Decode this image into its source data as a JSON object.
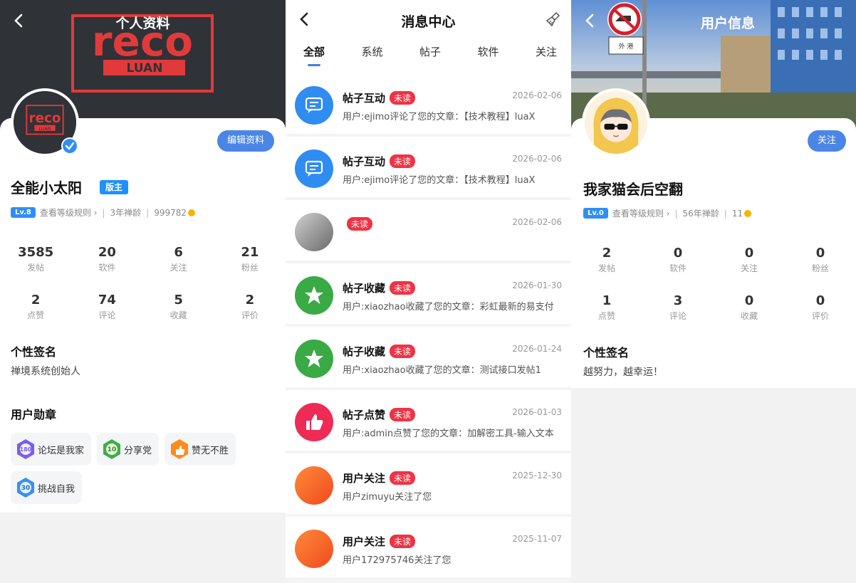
{
  "profile": {
    "title": "个人资料",
    "logo_text": "reco",
    "logo_sub": "LUAN",
    "edit_label": "编辑资料",
    "username": "全能小太阳",
    "role": "版主",
    "level": "Lv.8",
    "level_rule": "查看等级规则 ›",
    "age": "3年禅龄",
    "coins": "999782",
    "stats_row1": [
      {
        "n": "3585",
        "l": "发帖"
      },
      {
        "n": "20",
        "l": "软件"
      },
      {
        "n": "6",
        "l": "关注"
      },
      {
        "n": "21",
        "l": "粉丝"
      }
    ],
    "stats_row2": [
      {
        "n": "2",
        "l": "点赞"
      },
      {
        "n": "74",
        "l": "评论"
      },
      {
        "n": "5",
        "l": "收藏"
      },
      {
        "n": "2",
        "l": "评价"
      }
    ],
    "sig_title": "个性签名",
    "sig_text": "禅境系统创始人",
    "medal_title": "用户勋章",
    "medals": [
      {
        "label": "论坛是我家",
        "badge": "180",
        "color": "#7b5cf0"
      },
      {
        "label": "分享党",
        "badge": "10",
        "color": "#3fae49"
      },
      {
        "label": "赞无不胜",
        "badge": "",
        "color": "#ff8c1a"
      },
      {
        "label": "挑战自我",
        "badge": "30",
        "color": "#3b8ff0"
      }
    ]
  },
  "messages": {
    "title": "消息中心",
    "tabs": [
      "全部",
      "系统",
      "帖子",
      "软件",
      "关注"
    ],
    "active_tab": "全部",
    "unread_label": "未读",
    "items": [
      {
        "type": "帖子互动",
        "date": "2026-02-06",
        "body": "用户:ejimo评论了您的文章：【技术教程】luaX",
        "icon": "comment-icon",
        "color": "#2f8cf0"
      },
      {
        "type": "帖子互动",
        "date": "2026-02-06",
        "body": "用户:ejimo评论了您的文章：【技术教程】luaX",
        "icon": "comment-icon",
        "color": "#2f8cf0"
      },
      {
        "type": "",
        "date": "2026-02-06",
        "body": "",
        "icon": "system-icon",
        "color": "#8a8a8a"
      },
      {
        "type": "帖子收藏",
        "date": "2026-01-30",
        "body": "用户:xiaozhao收藏了您的文章：彩虹最新的易支付",
        "icon": "star-icon",
        "color": "#3aaa45"
      },
      {
        "type": "帖子收藏",
        "date": "2026-01-24",
        "body": "用户:xiaozhao收藏了您的文章：测试接口发帖1",
        "icon": "star-icon",
        "color": "#3aaa45"
      },
      {
        "type": "帖子点赞",
        "date": "2026-01-03",
        "body": "用户:admin点赞了您的文章：加解密工具-输入文本",
        "icon": "thumb-up-icon",
        "color": "#ee2a55"
      },
      {
        "type": "用户关注",
        "date": "2025-12-30",
        "body": "用户zimuyu关注了您",
        "icon": "follow-icon",
        "color": "#ff6a2a"
      },
      {
        "type": "用户关注",
        "date": "2025-11-07",
        "body": "用户172975746关注了您",
        "icon": "follow-icon",
        "color": "#ff6a2a"
      }
    ]
  },
  "userinfo": {
    "title": "用户信息",
    "follow_label": "关注",
    "username": "我家猫会后空翻",
    "level": "Lv.0",
    "level_rule": "查看等级规则 ›",
    "age": "56年禅龄",
    "coins": "11",
    "stats_row1": [
      {
        "n": "2",
        "l": "发帖"
      },
      {
        "n": "0",
        "l": "软件"
      },
      {
        "n": "0",
        "l": "关注"
      },
      {
        "n": "0",
        "l": "粉丝"
      }
    ],
    "stats_row2": [
      {
        "n": "1",
        "l": "点赞"
      },
      {
        "n": "3",
        "l": "评论"
      },
      {
        "n": "0",
        "l": "收藏"
      },
      {
        "n": "0",
        "l": "评价"
      }
    ],
    "sig_title": "个性签名",
    "sig_text": "越努力，越幸运！",
    "sign_text": "外 港"
  }
}
